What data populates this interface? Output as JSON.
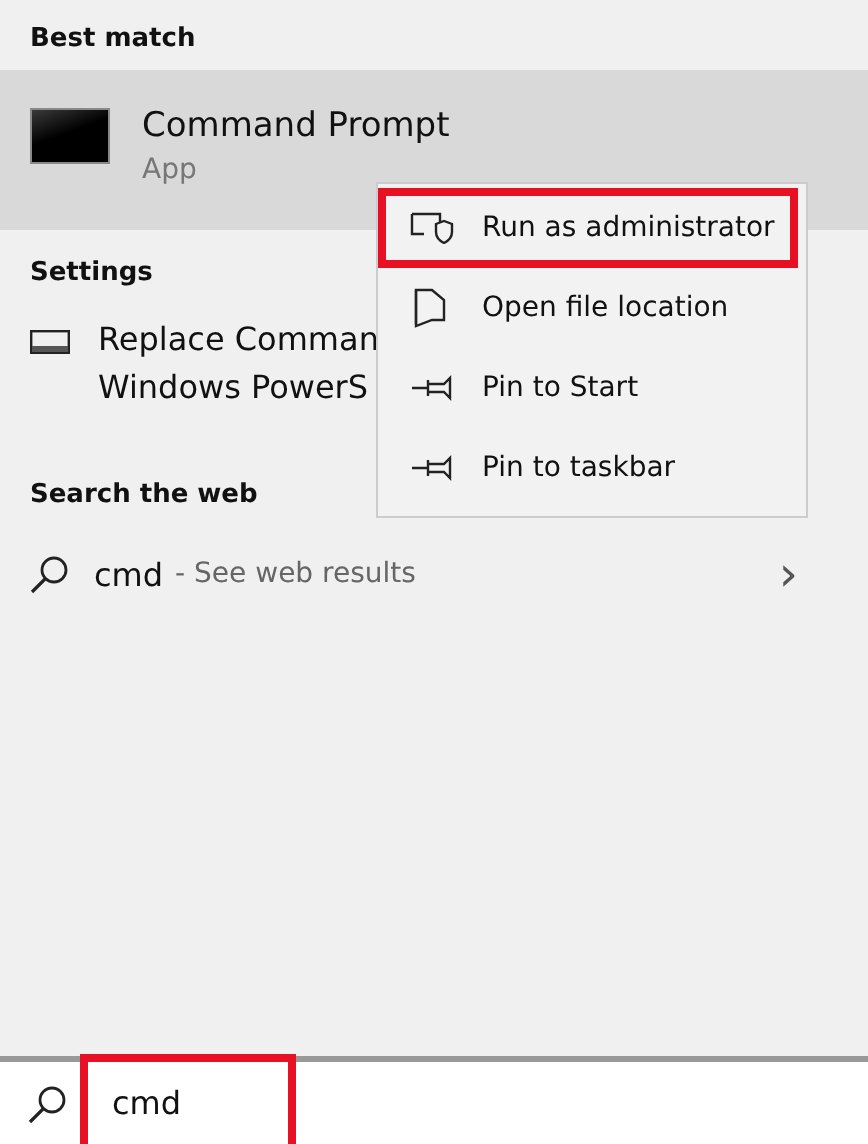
{
  "best_match": {
    "heading": "Best match",
    "result": {
      "title": "Command Prompt",
      "subtitle": "App",
      "selected": true
    }
  },
  "settings": {
    "heading": "Settings",
    "item": {
      "lines": [
        "Replace Comman",
        "Windows PowerS"
      ]
    }
  },
  "web": {
    "heading": "Search the web",
    "query": "cmd",
    "suffix": "- See web results",
    "chevron": "›"
  },
  "context_menu": {
    "items": [
      {
        "kind": "shield",
        "label": "Run as administrator",
        "highlighted": true
      },
      {
        "kind": "folder",
        "label": "Open file location",
        "highlighted": false
      },
      {
        "kind": "pin",
        "label": "Pin to Start",
        "highlighted": false
      },
      {
        "kind": "pin",
        "label": "Pin to taskbar",
        "highlighted": false
      }
    ]
  },
  "search_bar": {
    "value": "cmd",
    "highlighted": true
  }
}
